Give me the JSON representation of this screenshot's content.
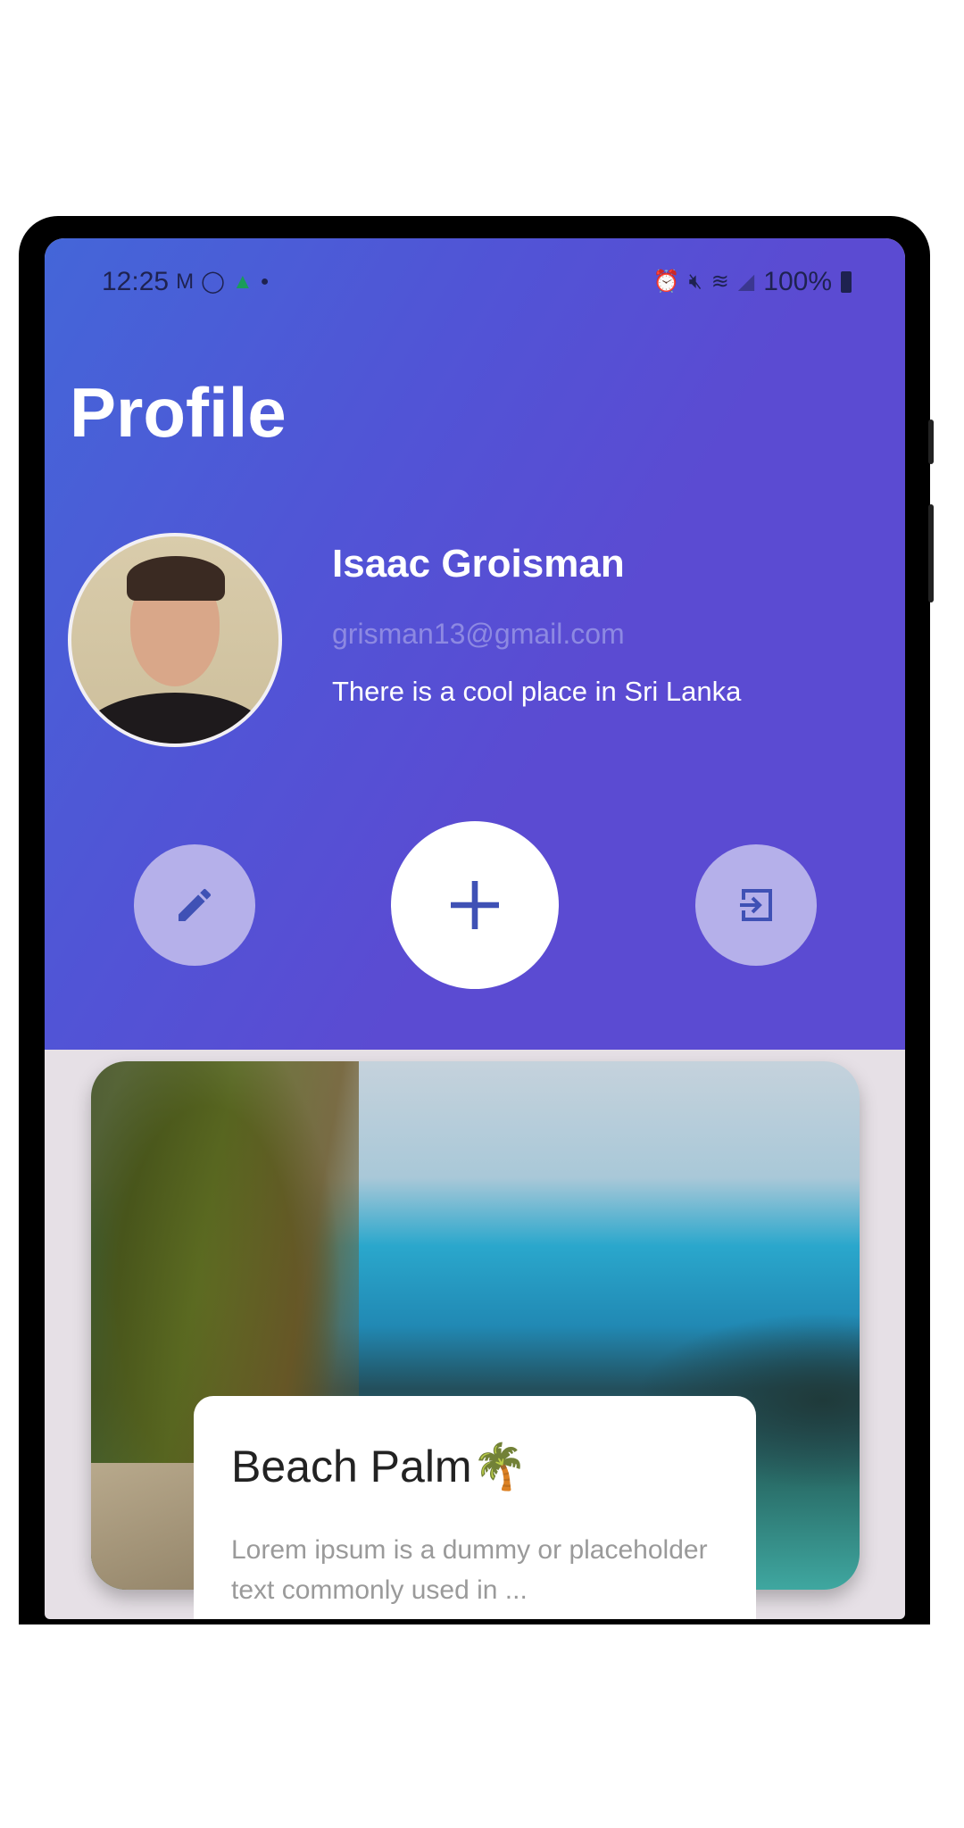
{
  "status_bar": {
    "time": "12:25",
    "battery": "100%",
    "left_icons": [
      "gmail-icon",
      "whatsapp-icon",
      "drive-icon",
      "dot-icon"
    ],
    "right_icons": [
      "alarm-icon",
      "mute-icon",
      "wifi-icon",
      "signal-icon",
      "battery-icon"
    ]
  },
  "header": {
    "title": "Profile"
  },
  "profile": {
    "name": "Isaac Groisman",
    "email": "grisman13@gmail.com",
    "bio": "There is a cool place in Sri Lanka"
  },
  "actions": {
    "edit": "edit-icon",
    "add": "plus-icon",
    "logout": "logout-icon"
  },
  "card": {
    "title": "Beach Palm🌴",
    "description": "Lorem ipsum is a dummy or placeholder text commonly used in ..."
  },
  "colors": {
    "header_start": "#4466d8",
    "header_end": "#5b4bd2",
    "fab_light": "#b5b0ea",
    "icon_blue": "#3f51b5",
    "email": "#8d89e2"
  }
}
